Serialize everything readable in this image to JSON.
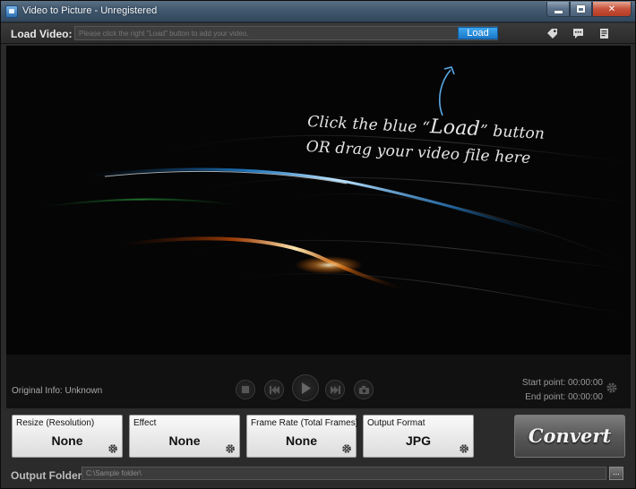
{
  "window": {
    "title": "Video to Picture - Unregistered"
  },
  "load_bar": {
    "label": "Load Video:",
    "input_placeholder": "Please click the right \"Load\" button to add your video.",
    "load_button": "Load"
  },
  "toolbar_icons": [
    "tag-icon",
    "chat-icon",
    "notes-icon"
  ],
  "video_area": {
    "hint_line1_prefix": "Click the blue “",
    "hint_line1_emph": "Load",
    "hint_line1_suffix": "” button",
    "hint_line2": "OR drag your video file here"
  },
  "player": {
    "original_info": "Original Info: Unknown",
    "start_point": "Start point: 00:00:00",
    "end_point": "End point: 00:00:00",
    "buttons": [
      "stop",
      "previous",
      "play",
      "next",
      "snapshot"
    ]
  },
  "settings": [
    {
      "title": "Resize (Resolution)",
      "value": "None"
    },
    {
      "title": "Effect",
      "value": "None"
    },
    {
      "title": "Frame Rate (Total Frames)",
      "value": "None"
    },
    {
      "title": "Output Format",
      "value": "JPG"
    }
  ],
  "convert_button": "Convert",
  "output": {
    "label": "Output Folder:",
    "value": "C:\\Sample folder\\",
    "browse_button": "..."
  },
  "colors": {
    "load_button": "#2289d8",
    "panel_bg": "#ececec",
    "video_bg": "#050505"
  }
}
